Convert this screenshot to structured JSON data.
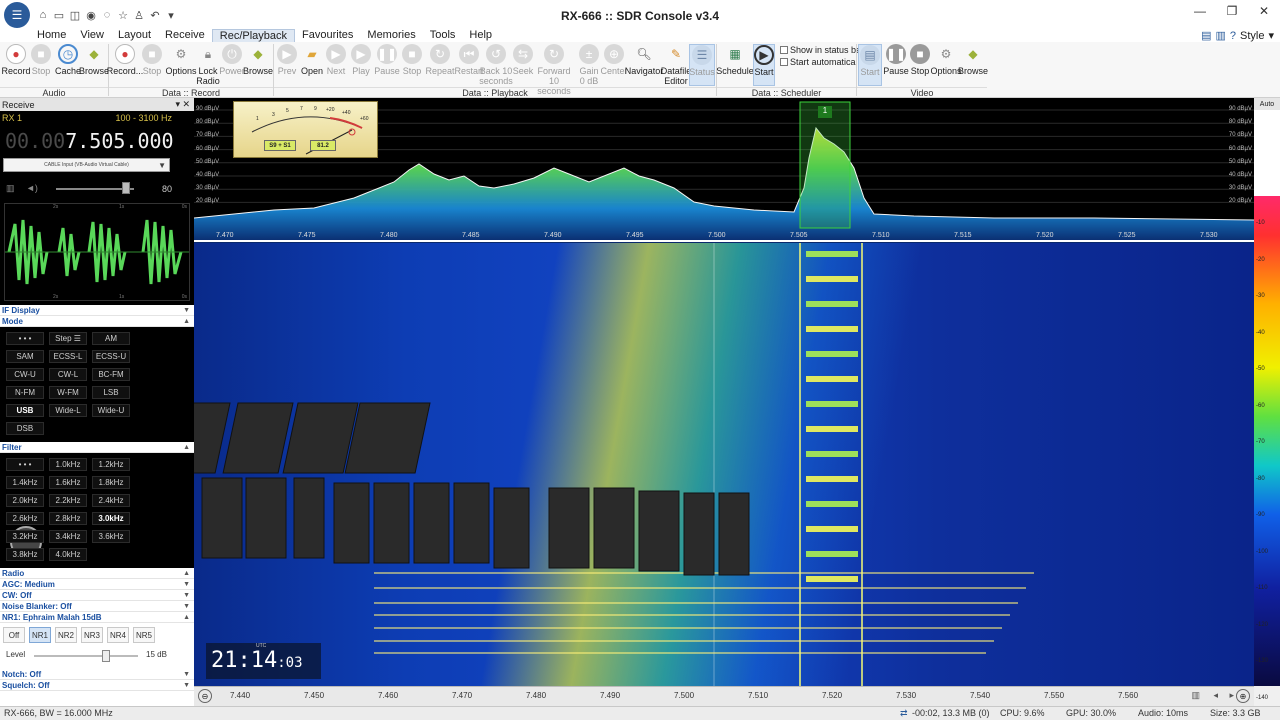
{
  "window": {
    "title": "RX-666 :: SDR Console v3.4",
    "minimize": "—",
    "restore": "❐",
    "close": "✕"
  },
  "quick_access": [
    "⌂",
    "▭",
    "◫",
    "◉",
    "◌",
    "☆",
    "♙",
    "↶",
    "▾"
  ],
  "menu": {
    "items": [
      "Home",
      "View",
      "Layout",
      "Receive",
      "Rec/Playback",
      "Favourites",
      "Memories",
      "Tools",
      "Help"
    ],
    "active": "Rec/Playback",
    "style_label": "Style"
  },
  "ribbon": {
    "buttons": [
      {
        "label": "Record",
        "icon": "record-icon"
      },
      {
        "label": "Stop",
        "icon": "stop-icon"
      },
      {
        "label": "Cache",
        "icon": "cache-icon"
      },
      {
        "label": "Browse",
        "icon": "browse-icon"
      },
      {
        "label": "Record...",
        "icon": "record-icon"
      },
      {
        "label": "Stop",
        "icon": "stop-icon"
      },
      {
        "label": "Options",
        "icon": "gear-icon"
      },
      {
        "label": "Lock Radio",
        "icon": "lock-icon"
      },
      {
        "label": "Power",
        "icon": "power-icon"
      },
      {
        "label": "Browse",
        "icon": "browse-icon"
      },
      {
        "label": "Prev",
        "icon": "prev-icon"
      },
      {
        "label": "Open",
        "icon": "folder-icon"
      },
      {
        "label": "Next",
        "icon": "next-icon"
      },
      {
        "label": "Play",
        "icon": "play-icon"
      },
      {
        "label": "Pause",
        "icon": "pause-icon"
      },
      {
        "label": "Stop",
        "icon": "stop-icon"
      },
      {
        "label": "Repeat",
        "icon": "repeat-icon"
      },
      {
        "label": "Restart",
        "icon": "restart-icon"
      },
      {
        "label": "Back 10 seconds",
        "icon": "back-icon"
      },
      {
        "label": "Seek",
        "icon": "seek-icon"
      },
      {
        "label": "Forward 10 seconds",
        "icon": "forward-icon"
      },
      {
        "label": "Gain 0 dB",
        "icon": "gain-icon"
      },
      {
        "label": "Center",
        "icon": "center-icon"
      },
      {
        "label": "Navigator",
        "icon": "navigator-icon"
      },
      {
        "label": "Datafile Editor",
        "icon": "edit-icon"
      },
      {
        "label": "Status",
        "icon": "status-icon"
      },
      {
        "label": "Schedule",
        "icon": "schedule-icon"
      },
      {
        "label": "Start",
        "icon": "start-icon"
      },
      {
        "label": "Start",
        "icon": "start-icon"
      },
      {
        "label": "Pause",
        "icon": "pause-icon"
      },
      {
        "label": "Stop",
        "icon": "stop-icon"
      },
      {
        "label": "Options",
        "icon": "gear-icon"
      },
      {
        "label": "Browse",
        "icon": "browse-icon"
      }
    ],
    "checkboxes": [
      "Show in status bar",
      "Start automatically"
    ],
    "groups": [
      "Audio",
      "Data :: Record",
      "Data :: Playback",
      "Data :: Scheduler",
      "Video"
    ]
  },
  "receive_panel": {
    "title": "Receive",
    "rx": "RX 1",
    "bandwidth": "100 - 3100 Hz",
    "frequency_dim": "00.00",
    "frequency_main": "7.505.000",
    "audio_device": "CABLE Input (VB-Audio Virtual Cable)",
    "volume": "80",
    "scope_ticks": [
      "2s",
      "1s",
      "0s",
      "2s",
      "1s",
      "0s"
    ]
  },
  "sections": {
    "if_display": "IF Display",
    "mode": "Mode",
    "filter": "Filter",
    "radio": "Radio",
    "agc": "AGC: Medium",
    "cw": "CW: Off",
    "noise_blanker": "Noise Blanker: Off",
    "nr1": "NR1: Ephraim Malah 15dB",
    "level_label": "Level",
    "level_value": "15 dB",
    "notch": "Notch: Off",
    "squelch": "Squelch: Off"
  },
  "mode_buttons": [
    "• • •",
    "Step ☰",
    "AM",
    "SAM",
    "ECSS-L",
    "ECSS-U",
    "CW-U",
    "CW-L",
    "BC-FM",
    "N-FM",
    "W-FM",
    "LSB",
    "USB",
    "Wide-L",
    "Wide-U",
    "DSB"
  ],
  "mode_active": "USB",
  "filter_buttons": [
    "• • •",
    "1.0kHz",
    "1.2kHz",
    "1.4kHz",
    "1.6kHz",
    "1.8kHz",
    "2.0kHz",
    "2.2kHz",
    "2.4kHz",
    "2.6kHz",
    "2.8kHz",
    "3.0kHz",
    "3.2kHz",
    "3.4kHz",
    "3.6kHz",
    "3.8kHz",
    "4.0kHz"
  ],
  "filter_active": "3.0kHz",
  "nr_buttons": [
    "Off",
    "NR1",
    "NR2",
    "NR3",
    "NR4",
    "NR5"
  ],
  "nr_active": "NR1",
  "meter": {
    "s_reading": "S9 + S1",
    "value": "81.2",
    "scale": [
      "1",
      "3",
      "5",
      "7",
      "9",
      "+20",
      "+40",
      "+60"
    ]
  },
  "spectrum": {
    "db_labels": [
      "90 dBµV",
      "80 dBµV",
      "70 dBµV",
      "60 dBµV",
      "50 dBµV",
      "40 dBµV",
      "30 dBµV",
      "20 dBµV"
    ],
    "freq_ticks": [
      "7.470",
      "7.475",
      "7.480",
      "7.485",
      "7.490",
      "7.495",
      "7.500",
      "7.505",
      "7.510",
      "7.515",
      "7.520",
      "7.525",
      "7.530"
    ],
    "marker": "1",
    "auto_label": "Auto"
  },
  "colorscale_labels": [
    "-10",
    "-20",
    "-30",
    "-40",
    "-50",
    "-60",
    "-70",
    "-80",
    "-90",
    "-100",
    "-110",
    "-120",
    "-130",
    "-140",
    "-150"
  ],
  "waterfall": {
    "utc_label": "UTC",
    "time_main": "21:14",
    "time_sec": ":03"
  },
  "bottom_axis": [
    "7.440",
    "7.450",
    "7.460",
    "7.470",
    "7.480",
    "7.490",
    "7.500",
    "7.510",
    "7.520",
    "7.530",
    "7.540",
    "7.550",
    "7.560"
  ],
  "status": {
    "left": "RX-666, BW = 16.000 MHz",
    "time": "-00:02, 13.3 MB (0)",
    "cpu": "CPU: 9.6%",
    "gpu": "GPU: 30.0%",
    "audio": "Audio: 10ms",
    "size": "Size: 3.3 GB"
  },
  "colors": {
    "accent": "#2a5b9a",
    "signal_green": "#4fd24f",
    "waterfall_blue": "#0d3db4",
    "record_red": "#d23b3b"
  }
}
